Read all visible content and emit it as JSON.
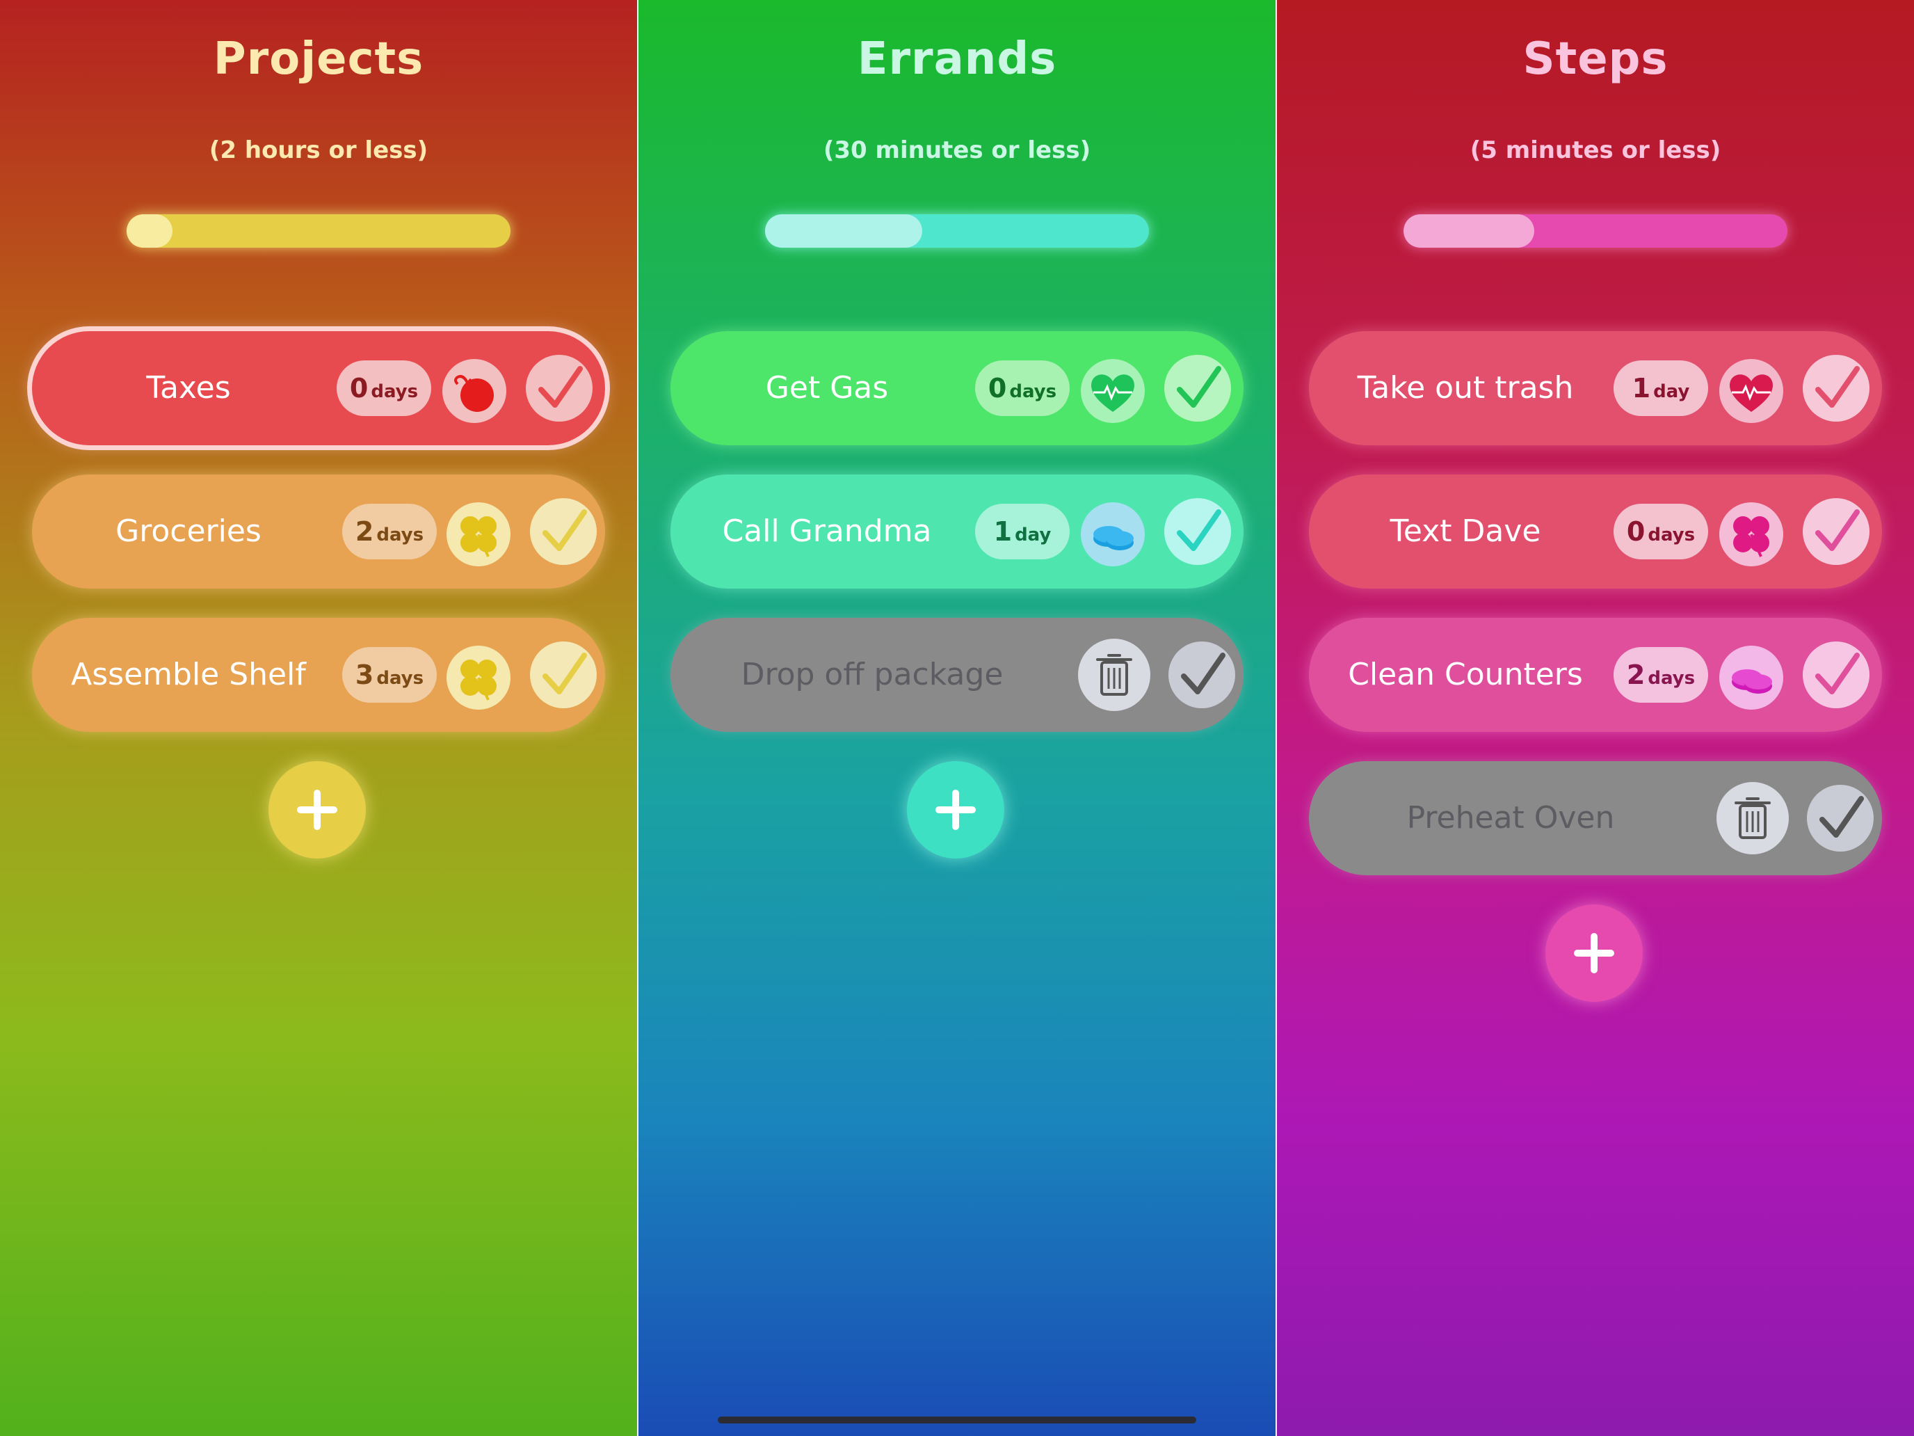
{
  "columns": [
    {
      "title": "Projects",
      "subtitle": "(2 hours or less)",
      "progress": 0.12,
      "tasks": [
        {
          "label": "Taxes",
          "days_num": "0",
          "days_unit": "days",
          "icon": "bomb-icon",
          "state": "active"
        },
        {
          "label": "Groceries",
          "days_num": "2",
          "days_unit": "days",
          "icon": "clover-icon",
          "state": "pending"
        },
        {
          "label": "Assemble Shelf",
          "days_num": "3",
          "days_unit": "days",
          "icon": "clover-icon",
          "state": "pending"
        }
      ],
      "add_button": "plus-icon"
    },
    {
      "title": "Errands",
      "subtitle": "(30 minutes or less)",
      "progress": 0.41,
      "tasks": [
        {
          "label": "Get Gas",
          "days_num": "0",
          "days_unit": "days",
          "icon": "heart-pulse-icon",
          "state": "pending"
        },
        {
          "label": "Call Grandma",
          "days_num": "1",
          "days_unit": "day",
          "icon": "coins-icon",
          "state": "pending"
        },
        {
          "label": "Drop off package",
          "icon": "trash-icon",
          "state": "completed"
        }
      ],
      "add_button": "plus-icon"
    },
    {
      "title": "Steps",
      "subtitle": "(5 minutes or less)",
      "progress": 0.34,
      "tasks": [
        {
          "label": "Take out trash",
          "days_num": "1",
          "days_unit": "day",
          "icon": "heart-pulse-icon",
          "state": "pending"
        },
        {
          "label": "Text Dave",
          "days_num": "0",
          "days_unit": "days",
          "icon": "clover-icon",
          "state": "pending"
        },
        {
          "label": "Clean Counters",
          "days_num": "2",
          "days_unit": "days",
          "icon": "coins-icon",
          "state": "pending"
        },
        {
          "label": "Preheat Oven",
          "icon": "trash-icon",
          "state": "completed"
        }
      ],
      "add_button": "plus-icon"
    }
  ],
  "colors": {
    "projects_accent": "#e6cf46",
    "errands_accent": "#4ee6cc",
    "steps_accent": "#e64aae",
    "completed_row": "#8a8a8a"
  }
}
